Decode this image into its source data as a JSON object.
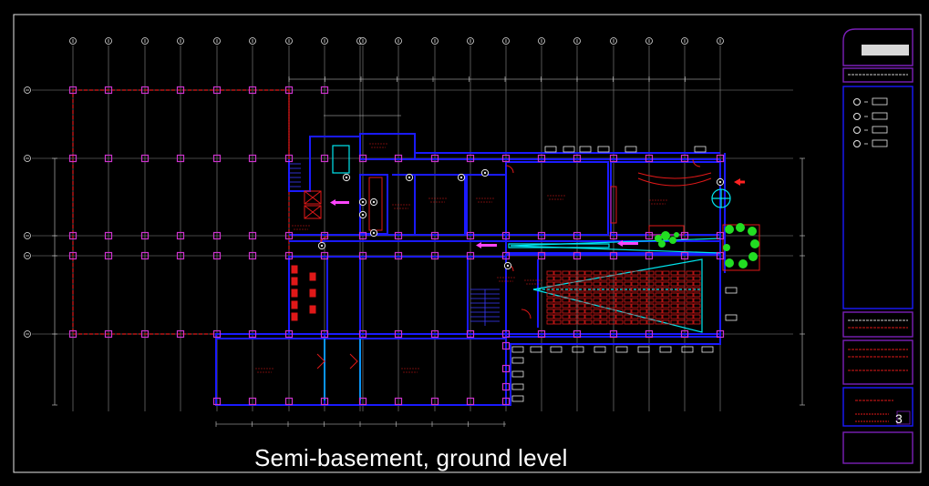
{
  "caption": "Semi-basement, ground level",
  "title_block": {
    "sheet_number": "3"
  },
  "colors": {
    "background": "#000000",
    "walls": "#1a1aff",
    "columns": "#cc33cc",
    "grid": "#8c8c8c",
    "frame": "#7a1fb8",
    "dimensions": "#d0d0d0",
    "annotations": "#ff2020",
    "cyan": "#00e5ee",
    "plants": "#22ee22"
  }
}
